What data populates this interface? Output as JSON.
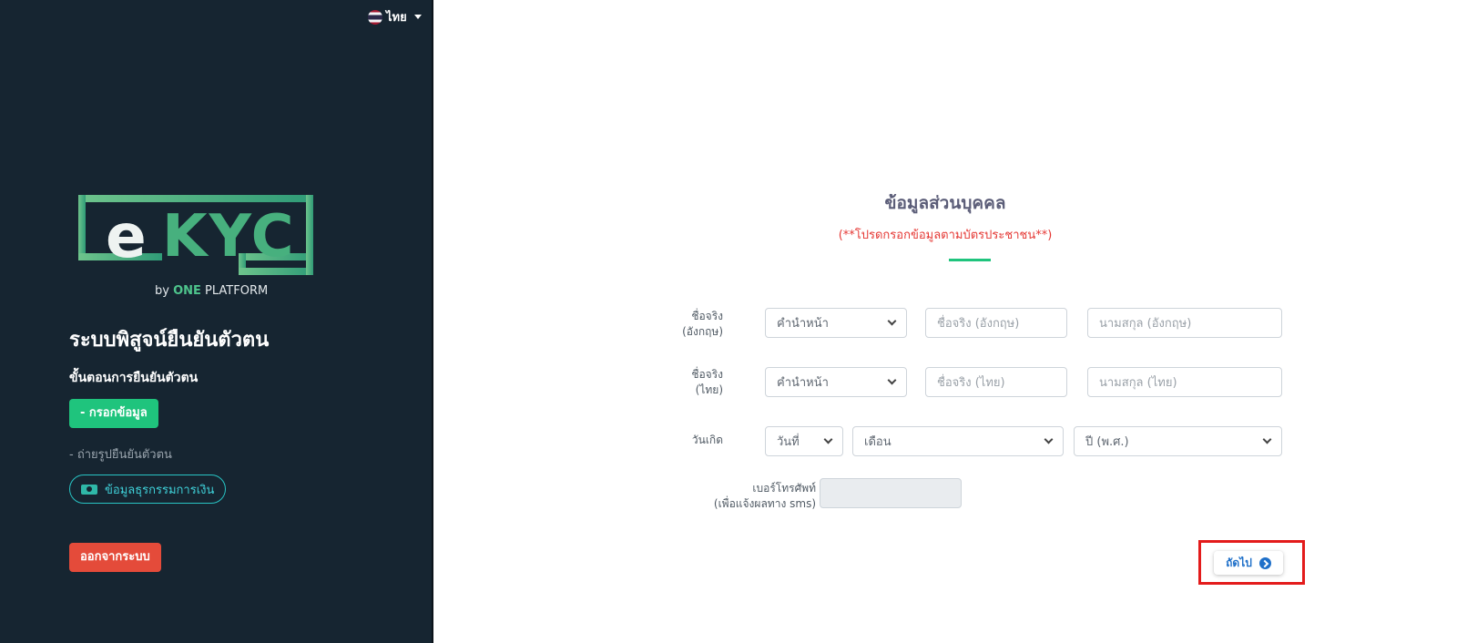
{
  "language": {
    "label": "ไทย"
  },
  "logo": {
    "letter_e": "e",
    "letters_kyc": "KYC",
    "by_prefix": "by",
    "one": "ONE",
    "platform": "PLATFORM"
  },
  "sidebar": {
    "system_title": "ระบบพิสูจน์ยืนยันตัวตน",
    "steps_title": "ขั้นตอนการยืนยันตัวตน",
    "step_fill": "- กรอกข้อมูล",
    "step_photo": "- ถ่ายรูปยืนยันตัวตน",
    "finance_button": "ข้อมูลธุรกรรมการเงิน",
    "logout_button": "ออกจากระบบ"
  },
  "form": {
    "title": "ข้อมูลส่วนบุคคล",
    "subtitle": "(**โปรดกรอกข้อมูลตามบัตรประชาชน**)",
    "name_en": {
      "label_line1": "ชื่อจริง",
      "label_line2": "(อังกฤษ)",
      "prefix_value": "คำนำหน้า",
      "first_placeholder": "ชื่อจริง (อังกฤษ)",
      "last_placeholder": "นามสกุล (อังกฤษ)"
    },
    "name_th": {
      "label_line1": "ชื่อจริง",
      "label_line2": "(ไทย)",
      "prefix_value": "คำนำหน้า",
      "first_placeholder": "ชื่อจริง (ไทย)",
      "last_placeholder": "นามสกุล (ไทย)"
    },
    "birthdate": {
      "label": "วันเกิด",
      "day_value": "วันที่",
      "month_value": "เดือน",
      "year_value": "ปี (พ.ศ.)"
    },
    "phone": {
      "label_line1": "เบอร์โทรศัพท์",
      "label_line2": "(เพื่อแจ้งผลทาง sms)",
      "value": ""
    },
    "next_button": "ถัดไป"
  }
}
